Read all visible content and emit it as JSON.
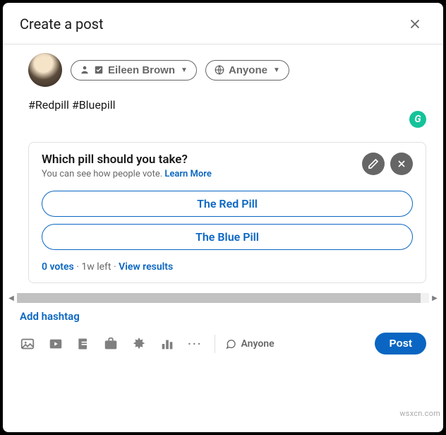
{
  "header": {
    "title": "Create a post"
  },
  "author": {
    "name": "Eileen Brown",
    "visibility": "Anyone"
  },
  "post": {
    "text": "#Redpill #Bluepill"
  },
  "poll": {
    "question": "Which pill should you take?",
    "subline_text": "You can see how people vote. ",
    "learn_more": "Learn More",
    "options": [
      {
        "label": "The Red Pill"
      },
      {
        "label": "The Blue Pill"
      }
    ],
    "votes_label": "0 votes",
    "dot1": " · ",
    "time_left": "1w left",
    "dot2": " · ",
    "view_results": "View results"
  },
  "actions": {
    "add_hashtag": "Add hashtag",
    "comment_setting": "Anyone",
    "post_button": "Post"
  },
  "watermark": "wsxcn.com",
  "grammarly_badge": "G"
}
